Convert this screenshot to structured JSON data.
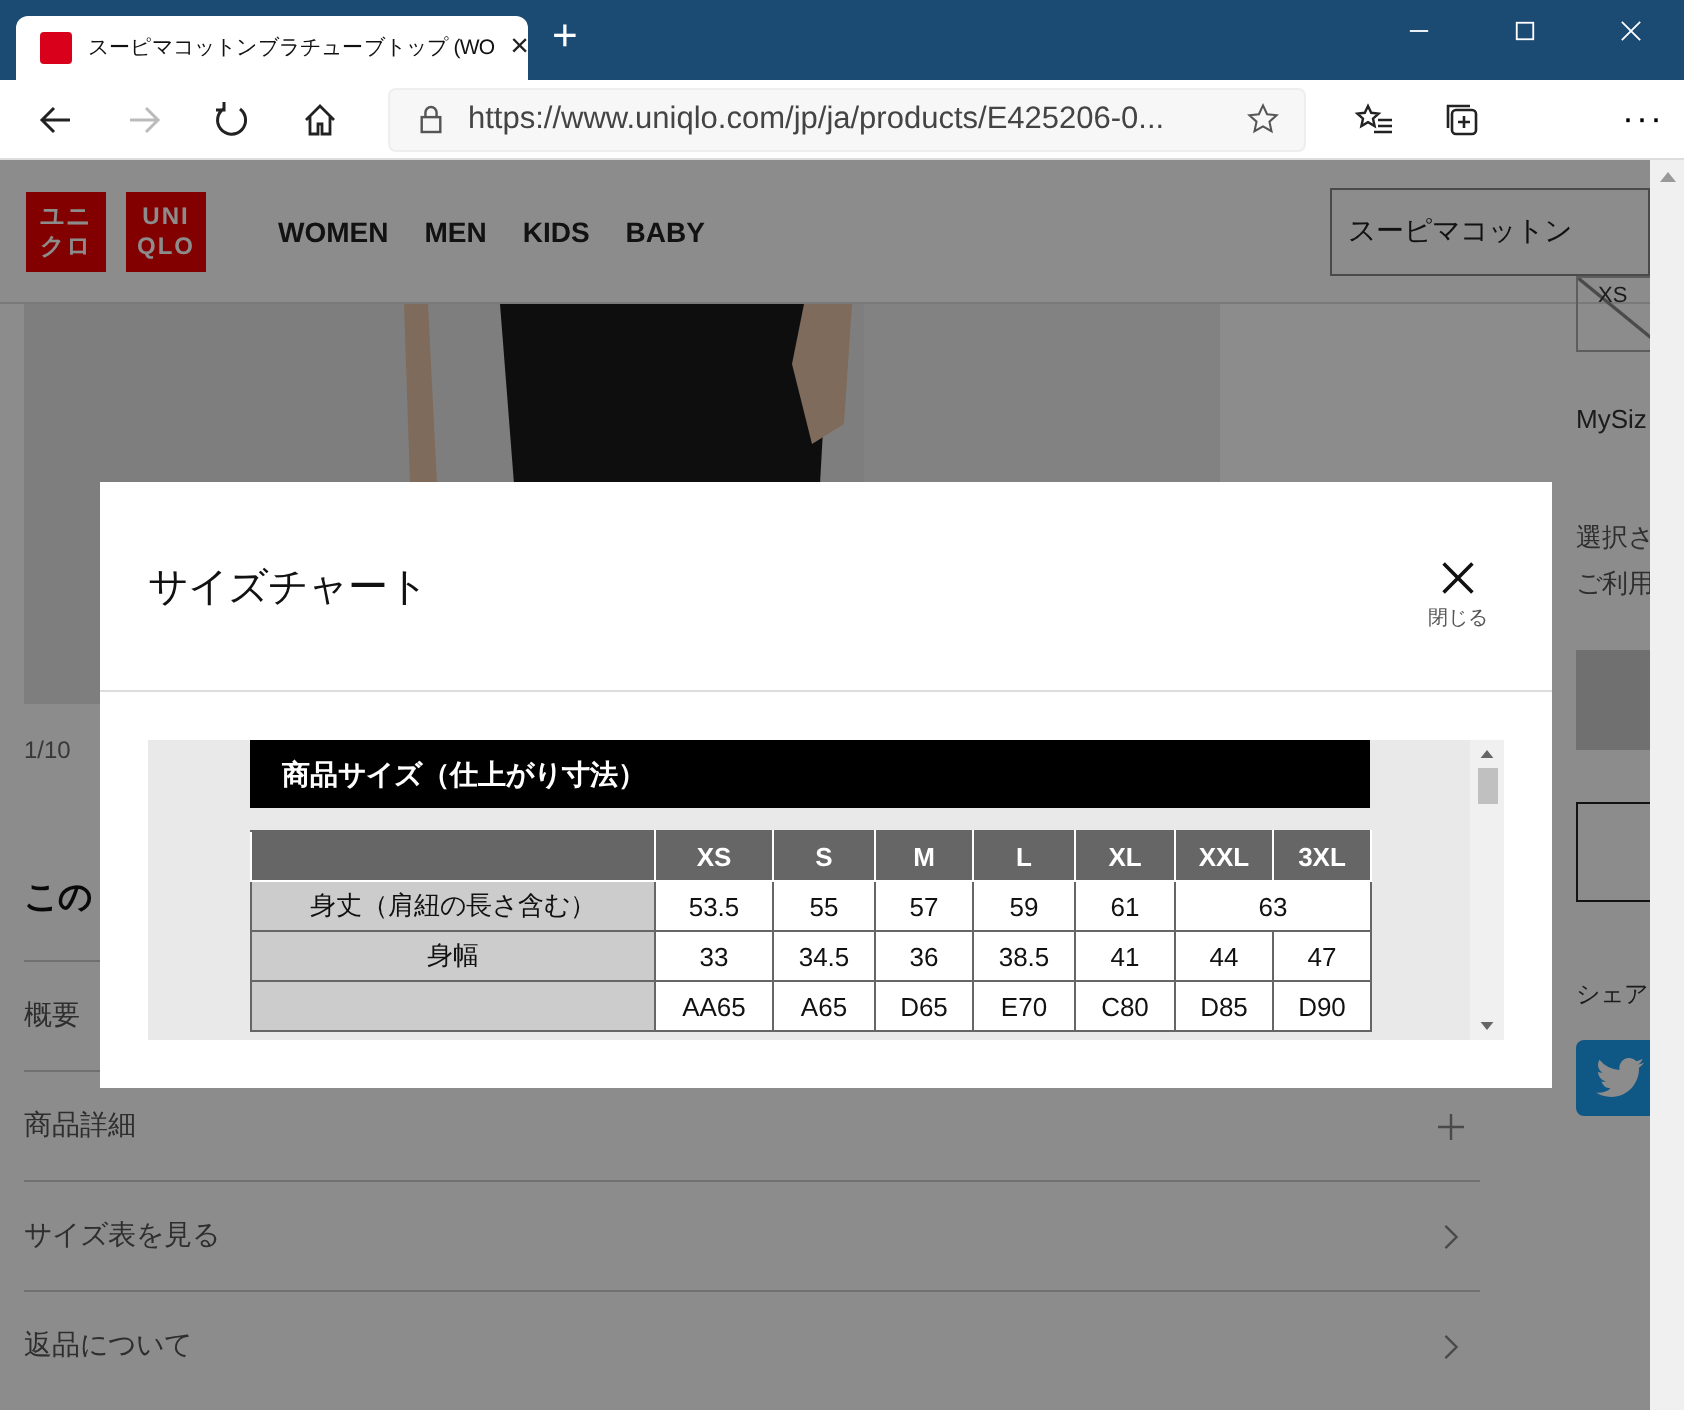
{
  "browser": {
    "tab": {
      "title": "スーピマコットンブラチューブトップ (WO",
      "close": "×"
    },
    "new_tab": "+",
    "address": "https://www.uniqlo.com/jp/ja/products/E425206-0...",
    "more": "···",
    "forward_disabled": true
  },
  "header": {
    "logos": [
      {
        "lines": [
          "ユニ",
          "クロ"
        ]
      },
      {
        "lines": [
          "UNI",
          "QLO"
        ]
      }
    ],
    "nav": [
      "WOMEN",
      "MEN",
      "KIDS",
      "BABY"
    ],
    "search": {
      "value": "スーピマコットン"
    }
  },
  "gallery": {
    "counter": "1/10"
  },
  "section_heading": "この",
  "accordion": [
    {
      "label": "概要",
      "kind": "plain"
    },
    {
      "label": "商品詳細",
      "kind": "plus"
    },
    {
      "label": "サイズ表を見る",
      "kind": "chevron"
    },
    {
      "label": "返品について",
      "kind": "chevron"
    }
  ],
  "sidebar": {
    "size_chip": {
      "label": "XS",
      "disabled": true
    },
    "mysize": "MySiz",
    "notice": [
      "選択さ",
      "ご利用"
    ],
    "share": "シェア"
  },
  "modal": {
    "title": "サイズチャート",
    "close_label": "閉じる",
    "chart": {
      "heading": "商品サイズ（仕上がり寸法）",
      "columns": [
        "XS",
        "S",
        "M",
        "L",
        "XL",
        "XXL",
        "3XL"
      ],
      "rows": [
        {
          "label": "身丈（肩紐の長さ含む）",
          "cells": [
            {
              "text": "53.5",
              "merged": false
            },
            {
              "text": "55",
              "merged": false
            },
            {
              "text": "57",
              "merged": false
            },
            {
              "text": "59",
              "merged": false
            },
            {
              "text": "61",
              "merged": false
            },
            {
              "text": "63",
              "merged": true,
              "colspan": 2
            }
          ]
        },
        {
          "label": "身幅",
          "cells": [
            {
              "text": "33",
              "merged": false
            },
            {
              "text": "34.5",
              "merged": false
            },
            {
              "text": "36",
              "merged": false
            },
            {
              "text": "38.5",
              "merged": false
            },
            {
              "text": "41",
              "merged": false
            },
            {
              "text": "44",
              "merged": false
            },
            {
              "text": "47",
              "merged": false
            }
          ]
        },
        {
          "cells": [
            {
              "text": "AA65",
              "merged": false
            },
            {
              "text": "A65",
              "merged": false
            },
            {
              "text": "D65",
              "merged": false
            },
            {
              "text": "E70",
              "merged": false
            },
            {
              "text": "C80",
              "merged": false
            },
            {
              "text": "D85",
              "merged": false
            },
            {
              "text": "D90",
              "merged": false
            }
          ]
        }
      ]
    }
  }
}
